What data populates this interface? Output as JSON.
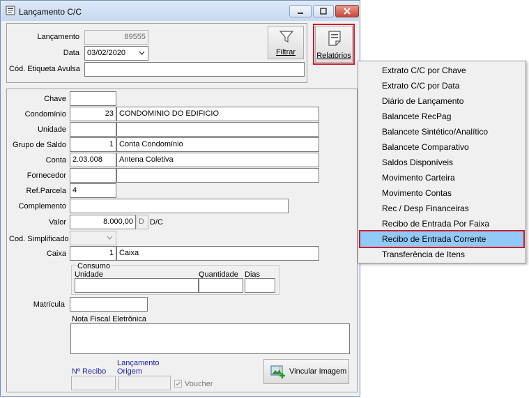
{
  "window": {
    "title": "Lançamento C/C"
  },
  "header": {
    "lancamento_label": "Lançamento",
    "lancamento_value": "89555",
    "data_label": "Data",
    "data_value": "03/02/2020",
    "etiqueta_label": "Cód. Etiqueta Avulsa",
    "etiqueta_value": "",
    "filtrar_label": "Filtrar",
    "relatorios_label": "Relatórios"
  },
  "form": {
    "chave_label": "Chave",
    "chave_value": "",
    "condominio_label": "Condomínio",
    "condominio_code": "23",
    "condominio_name": "CONDOMINIO DO EDIFICIO",
    "unidade_label": "Unidade",
    "grupo_label": "Grupo de Saldo",
    "grupo_code": "1",
    "grupo_name": "Conta Condomínio",
    "conta_label": "Conta",
    "conta_code": "2.03.008",
    "conta_name": "Antena Coletiva",
    "fornecedor_label": "Fornecedor",
    "refparcela_label": "Ref.Parcela",
    "refparcela_value": "4",
    "complemento_label": "Complemento",
    "valor_label": "Valor",
    "valor_value": "8.000,00",
    "dc_value": "D",
    "dc_label": "D/C",
    "codsimp_label": "Cod. Simplificado",
    "caixa_label": "Caixa",
    "caixa_code": "1",
    "caixa_name": "Caixa",
    "consumo_title": "Consumo",
    "consumo_unidade": "Unidade",
    "consumo_quantidade": "Quantidade",
    "consumo_dias": "Dias",
    "matricula_label": "Matrícula",
    "nfe_label": "Nota Fiscal Eletrônica",
    "recibo_label": "Nº Recibo",
    "lanc_origem_label": "Lançamento Origem",
    "voucher_label": "Voucher",
    "vincular_label": "Vincular Imagem"
  },
  "menu": {
    "items": [
      "Extrato C/C por Chave",
      "Extrato C/C por Data",
      "Diário de Lançamento",
      "Balancete RecPag",
      "Balancete Sintético/Analítico",
      "Balancete Comparativo",
      "Saldos Disponíveis",
      "Movimento Carteira",
      "Movimento Contas",
      "Rec / Desp Financeiras",
      "Recibo de Entrada Por Faixa",
      "Recibo de Entrada Corrente",
      "Transferência de Itens"
    ],
    "selected_index": 11
  },
  "colors": {
    "highlight": "#91c9f7",
    "annotation_red": "#d11a2a",
    "blue_label": "#1d1db4"
  }
}
